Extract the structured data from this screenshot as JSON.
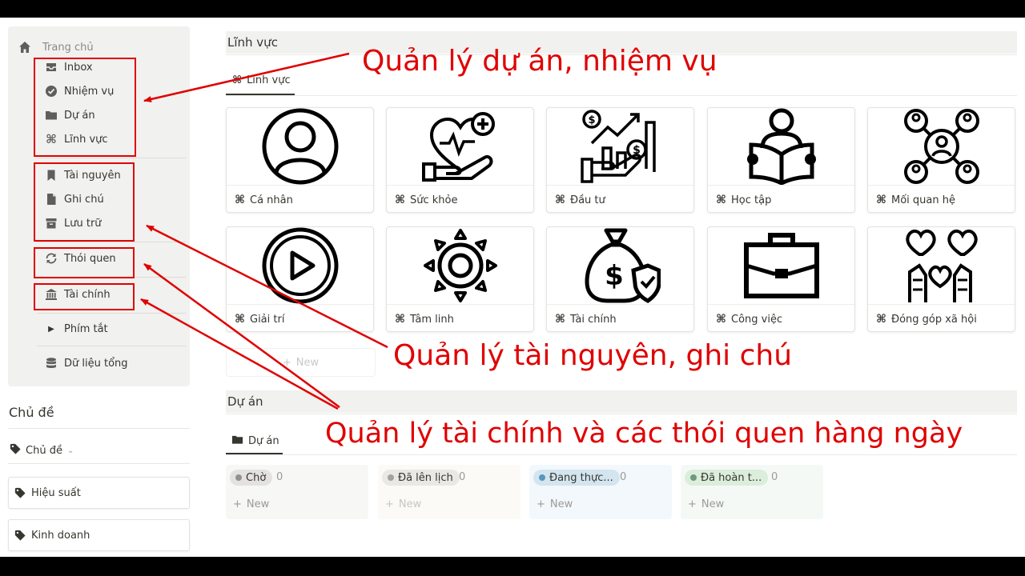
{
  "sidebar": {
    "home_label": "Trang chủ",
    "items": [
      {
        "label": "Inbox",
        "icon": "inbox-icon"
      },
      {
        "label": "Nhiệm vụ",
        "icon": "check-circle-icon"
      },
      {
        "label": "Dự án",
        "icon": "folder-icon"
      },
      {
        "label": "Lĩnh vực",
        "icon": "command-icon"
      },
      {
        "label": "Tài nguyên",
        "icon": "bookmark-icon"
      },
      {
        "label": "Ghi chú",
        "icon": "document-icon"
      },
      {
        "label": "Lưu trữ",
        "icon": "archive-icon"
      },
      {
        "label": "Thói quen",
        "icon": "repeat-icon"
      },
      {
        "label": "Tài chính",
        "icon": "bank-icon"
      },
      {
        "label": "Phím tắt",
        "icon": "triangle-right-icon"
      },
      {
        "label": "Dữ liệu tổng",
        "icon": "database-icon"
      }
    ]
  },
  "topics": {
    "heading": "Chủ đề",
    "toggle_label": "Chủ đề",
    "cards": [
      {
        "label": "Hiệu suất"
      },
      {
        "label": "Kinh doanh"
      }
    ]
  },
  "areas": {
    "heading": "Lĩnh vực",
    "view_tab": "Lĩnh vực",
    "cards": [
      {
        "title": "Cá nhân",
        "icon": "person-icon"
      },
      {
        "title": "Sức khỏe",
        "icon": "health-heart-icon"
      },
      {
        "title": "Đầu tư",
        "icon": "investment-icon"
      },
      {
        "title": "Học tập",
        "icon": "reading-icon"
      },
      {
        "title": "Mối quan hệ",
        "icon": "network-people-icon"
      },
      {
        "title": "Giải trí",
        "icon": "play-icon"
      },
      {
        "title": "Tâm linh",
        "icon": "sun-icon"
      },
      {
        "title": "Tài chính",
        "icon": "money-bag-icon"
      },
      {
        "title": "Công việc",
        "icon": "briefcase-icon"
      },
      {
        "title": "Đóng góp xã hội",
        "icon": "charity-icon"
      }
    ],
    "new_label": "New"
  },
  "projects": {
    "heading": "Dự án",
    "view_tab": "Dự án",
    "columns": [
      {
        "label": "Chờ",
        "count": "0",
        "new_label": "New",
        "bg": "#f7f7f5",
        "pill_bg": "#e3e2e0",
        "dot": "#91918e"
      },
      {
        "label": "Đã lên lịch",
        "count": "0",
        "new_label": "New",
        "bg": "#fbfaf6",
        "pill_bg": "#e9e8e4",
        "dot": "#a3a29e"
      },
      {
        "label": "Đang thực...",
        "count": "0",
        "new_label": "New",
        "bg": "#f3f8fc",
        "pill_bg": "#d3e5ef",
        "dot": "#5b97bd"
      },
      {
        "label": "Đã hoàn t...",
        "count": "0",
        "new_label": "New",
        "bg": "#f5f9f6",
        "pill_bg": "#dbeddb",
        "dot": "#6c9b7d"
      }
    ]
  },
  "annotations": {
    "note1": "Quản lý dự án, nhiệm vụ",
    "note2": "Quản lý tài nguyên, ghi chú",
    "note3": "Quản lý tài chính và các thói quen hàng ngày",
    "color": "#e00000"
  }
}
